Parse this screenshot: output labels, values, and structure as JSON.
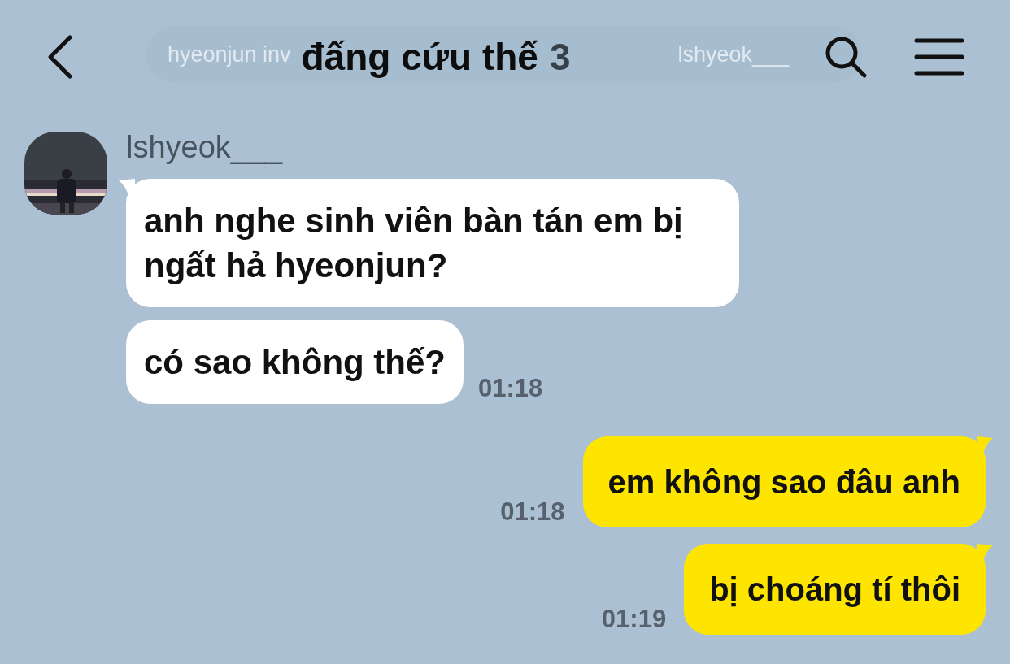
{
  "header": {
    "title": "đấng cứu thế",
    "member_count": "3",
    "banner": {
      "left_text": "hyeonjun inv",
      "right_text": "lshyeok___"
    }
  },
  "messages": [
    {
      "kind": "received",
      "sender": "lshyeok___",
      "avatar": {
        "kind": "picture"
      },
      "bubbles": [
        {
          "text": "anh nghe sinh viên bàn tán em bị ngất hả hyeonjun?"
        },
        {
          "text": "có sao không thế?",
          "time": "01:18"
        }
      ]
    },
    {
      "kind": "sent",
      "bubbles": [
        {
          "text": "em không sao đâu anh",
          "time": "01:18"
        }
      ]
    },
    {
      "kind": "sent",
      "bubbles": [
        {
          "text": "bị choáng tí thôi",
          "time": "01:19"
        }
      ]
    }
  ]
}
